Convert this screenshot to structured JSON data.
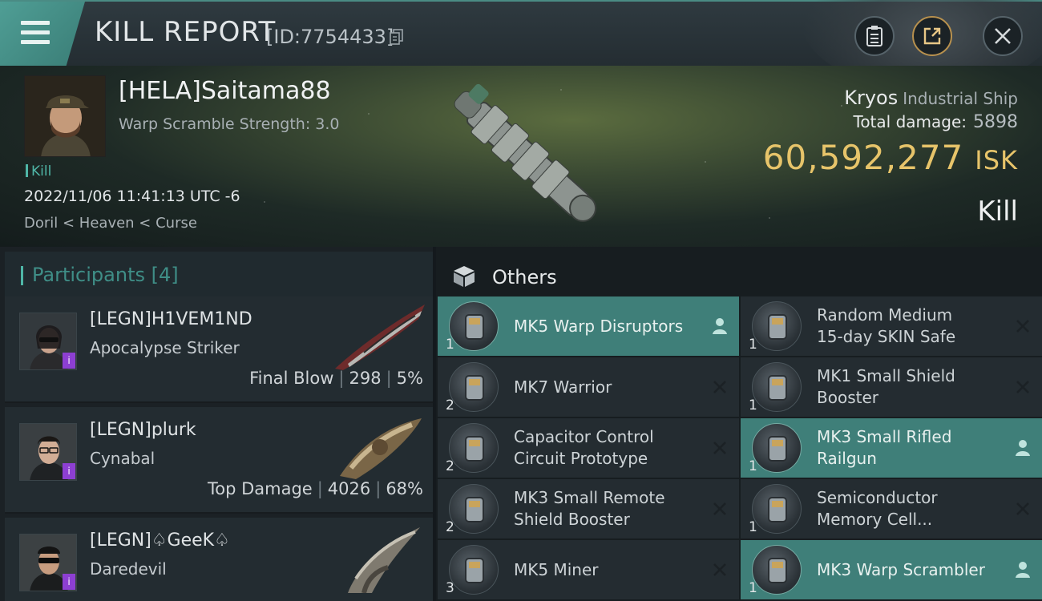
{
  "header": {
    "title": "KILL REPORT",
    "report_id": "[ID:7754433]"
  },
  "banner": {
    "victim_name": "[HELA]Saitama88",
    "warp_scramble": "Warp Scramble Strength: 3.0",
    "tag": "Kill",
    "timestamp": "2022/11/06 11:41:13 UTC -6",
    "location": "Doril < Heaven < Curse",
    "ship_name": "Kryos",
    "ship_class": "Industrial Ship",
    "total_damage_label": "Total damage:",
    "total_damage": "5898",
    "isk_value": "60,592,277",
    "isk_unit": "ISK",
    "result": "Kill"
  },
  "participants": {
    "title": "Participants",
    "count": "[4]",
    "rows": [
      {
        "name": "[LEGN]H1VEM1ND",
        "ship": "Apocalypse Striker",
        "stat_label": "Final Blow",
        "damage": "298",
        "percent": "5%"
      },
      {
        "name": "[LEGN]plurk",
        "ship": "Cynabal",
        "stat_label": "Top Damage",
        "damage": "4026",
        "percent": "68%"
      },
      {
        "name": "[LEGN]♤GeeK♤",
        "ship": "Daredevil"
      }
    ]
  },
  "others": {
    "title": "Others",
    "items": [
      {
        "name": "MK5 Warp Disruptors",
        "qty": "1",
        "state": "dropped",
        "icon": "warp-disruptor-icon"
      },
      {
        "name": "Random Medium\n15-day SKIN Safe",
        "qty": "1",
        "state": "destroyed",
        "icon": "skin-safe-icon"
      },
      {
        "name": "MK7  Warrior",
        "qty": "2",
        "state": "destroyed",
        "icon": "drone-icon"
      },
      {
        "name": "MK1 Small Shield\nBooster",
        "qty": "1",
        "state": "destroyed",
        "icon": "shield-booster-icon"
      },
      {
        "name": "Capacitor Control\nCircuit Prototype",
        "qty": "2",
        "state": "destroyed",
        "icon": "capacitor-rig-icon"
      },
      {
        "name": "MK3 Small Rifled\nRailgun",
        "qty": "1",
        "state": "dropped",
        "icon": "railgun-icon"
      },
      {
        "name": "MK3 Small Remote\nShield Booster",
        "qty": "2",
        "state": "destroyed",
        "icon": "remote-shield-icon"
      },
      {
        "name": "Semiconductor\nMemory Cell...",
        "qty": "1",
        "state": "destroyed",
        "icon": "memory-cell-icon"
      },
      {
        "name": "MK5 Miner",
        "qty": "3",
        "state": "destroyed",
        "icon": "miner-icon"
      },
      {
        "name": "MK3 Warp Scrambler",
        "qty": "1",
        "state": "dropped",
        "icon": "warp-scrambler-icon"
      }
    ]
  },
  "colors": {
    "accent_teal": "#4fb6a7",
    "isk_gold": "#e7c46a",
    "dropped_highlight": "#3f7f79",
    "corp_badge": "#8d3fd2"
  }
}
